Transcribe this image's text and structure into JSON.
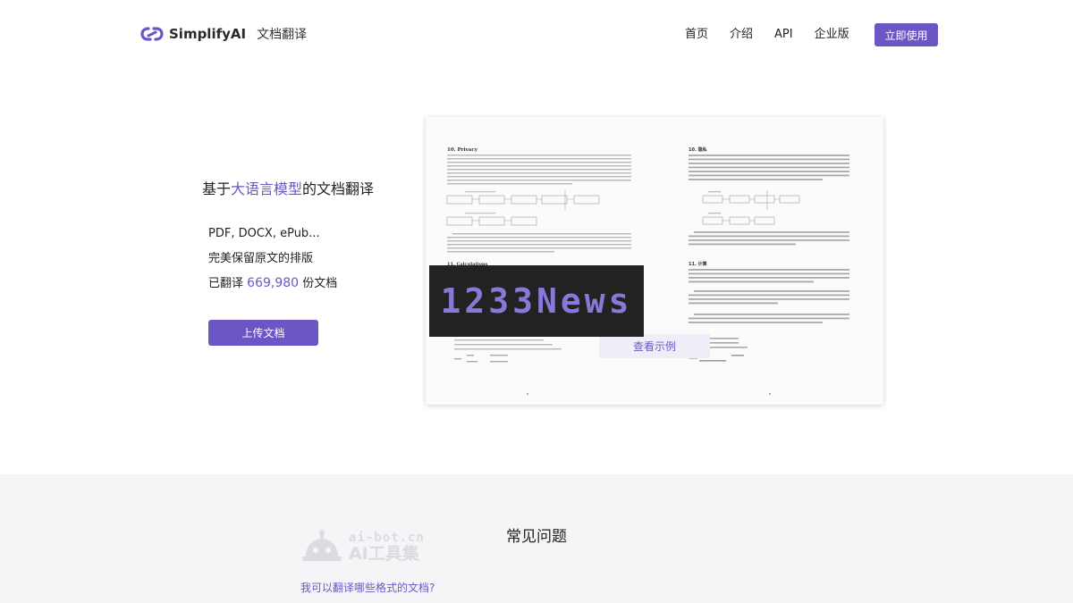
{
  "header": {
    "brand": "SimplifyAI",
    "subtitle": "文档翻译",
    "nav": [
      "首页",
      "介绍",
      "API",
      "企业版"
    ],
    "cta": "立即使用"
  },
  "hero": {
    "title_prefix": "基于",
    "title_accent": "大语言模型",
    "title_suffix": "的文档翻译",
    "formats": "PDF, DOCX, ePub...",
    "layout_note": "完美保留原文的排版",
    "translated_prefix": "已翻译",
    "translated_count": "669,980",
    "translated_suffix": "份文档",
    "upload_label": "上传文档"
  },
  "preview": {
    "left_heading_1": "10.  Privacy",
    "left_heading_2": "11.  Calculations",
    "right_heading_1": "10. 隐私",
    "right_heading_2": "11. 计算",
    "sample_label": "查看示例"
  },
  "overlay": {
    "watermark": "1233News"
  },
  "faq": {
    "title": "常见问题",
    "question_1": "我可以翻译哪些格式的文档?",
    "site_url": "ai-bot.cn",
    "site_name": "AI工具集"
  },
  "colors": {
    "accent": "#6c56c6"
  }
}
